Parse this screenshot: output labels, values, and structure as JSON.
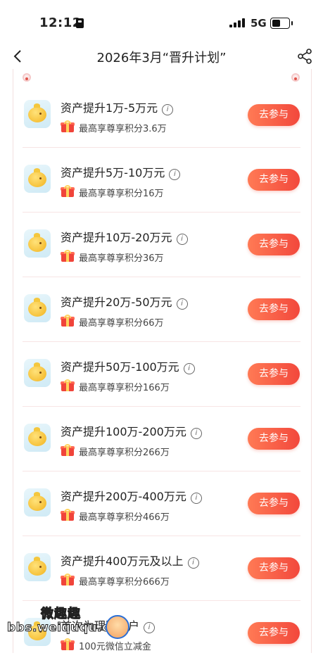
{
  "status_bar": {
    "time": "12:12",
    "network": "5G",
    "battery_level": 0.55
  },
  "nav": {
    "title": "2026年3月“晋升计划”",
    "back_icon": "chevron-left-icon",
    "share_icon": "share-icon"
  },
  "colors": {
    "accent": "#f2483c",
    "button_gradient_start": "#ff7a55"
  },
  "rows": [
    {
      "title": "资产提升1万-5万元",
      "reward": "最高享尊享积分3.6万",
      "button": "去参与"
    },
    {
      "title": "资产提升5万-10万元",
      "reward": "最高享尊享积分16万",
      "button": "去参与"
    },
    {
      "title": "资产提升10万-20万元",
      "reward": "最高享尊享积分36万",
      "button": "去参与"
    },
    {
      "title": "资产提升20万-50万元",
      "reward": "最高享尊享积分66万",
      "button": "去参与"
    },
    {
      "title": "资产提升50万-100万元",
      "reward": "最高享尊享积分166万",
      "button": "去参与"
    },
    {
      "title": "资产提升100万-200万元",
      "reward": "最高享尊享积分266万",
      "button": "去参与"
    },
    {
      "title": "资产提升200万-400万元",
      "reward": "最高享尊享积分466万",
      "button": "去参与"
    },
    {
      "title": "资产提升400万元及以上",
      "reward": "最高享尊享积分666万",
      "button": "去参与"
    },
    {
      "title": "首次为理财客户",
      "reward": "100元微信立减金",
      "button": "去参与"
    }
  ],
  "watermark": {
    "line1": "微趣趣",
    "line2": "bbs.weiququ.cn"
  }
}
